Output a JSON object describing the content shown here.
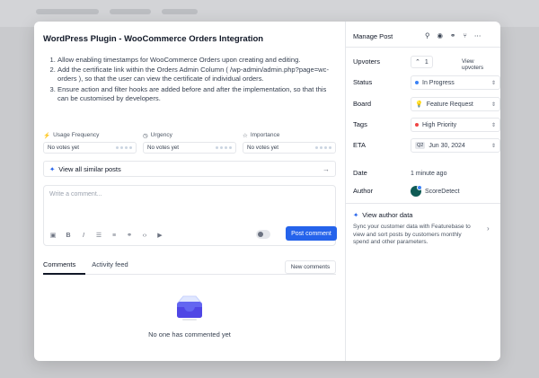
{
  "post": {
    "title": "WordPress Plugin - WooCommerce Orders Integration",
    "description": [
      "Allow enabling timestamps for WooCommerce Orders upon creating and editing.",
      "Add the certificate link within the Orders Admin Column ( /wp-admin/admin.php?page=wc-orders ), so that the user can view the certificate of individual orders.",
      "Ensure action and filter hooks are added before and after the implementation, so that this can be customised by developers."
    ]
  },
  "metrics": [
    {
      "label": "Usage Frequency",
      "value": "No votes yet",
      "icon": "pulse-icon"
    },
    {
      "label": "Urgency",
      "value": "No votes yet",
      "icon": "clock-icon"
    },
    {
      "label": "Importance",
      "value": "No votes yet",
      "icon": "star-icon"
    }
  ],
  "similar": {
    "label": "View all similar posts"
  },
  "composer": {
    "placeholder": "Write a comment...",
    "post_label": "Post comment"
  },
  "comments": {
    "tabs": [
      "Comments",
      "Activity feed"
    ],
    "sort_label": "New comments",
    "empty_text": "No one has commented yet"
  },
  "sidebar": {
    "header": "Manage Post",
    "upvoters": {
      "label": "Upvoters",
      "count": "1",
      "view": "View upvoters"
    },
    "status": {
      "label": "Status",
      "value": "In Progress",
      "color": "#3b82f6"
    },
    "board": {
      "label": "Board",
      "value": "Feature Request",
      "icon": "lightbulb-icon"
    },
    "tags": {
      "label": "Tags",
      "value": "High Priority",
      "color": "#ef4444"
    },
    "eta": {
      "label": "ETA",
      "quarter": "Q2",
      "value": "Jun 30, 2024"
    },
    "date": {
      "label": "Date",
      "value": "1 minute ago"
    },
    "author": {
      "label": "Author",
      "value": "ScoreDetect"
    },
    "author_data": {
      "title": "View author data",
      "text": "Sync your customer data with Featurebase to view and sort posts by customers monthly spend and other parameters."
    }
  }
}
